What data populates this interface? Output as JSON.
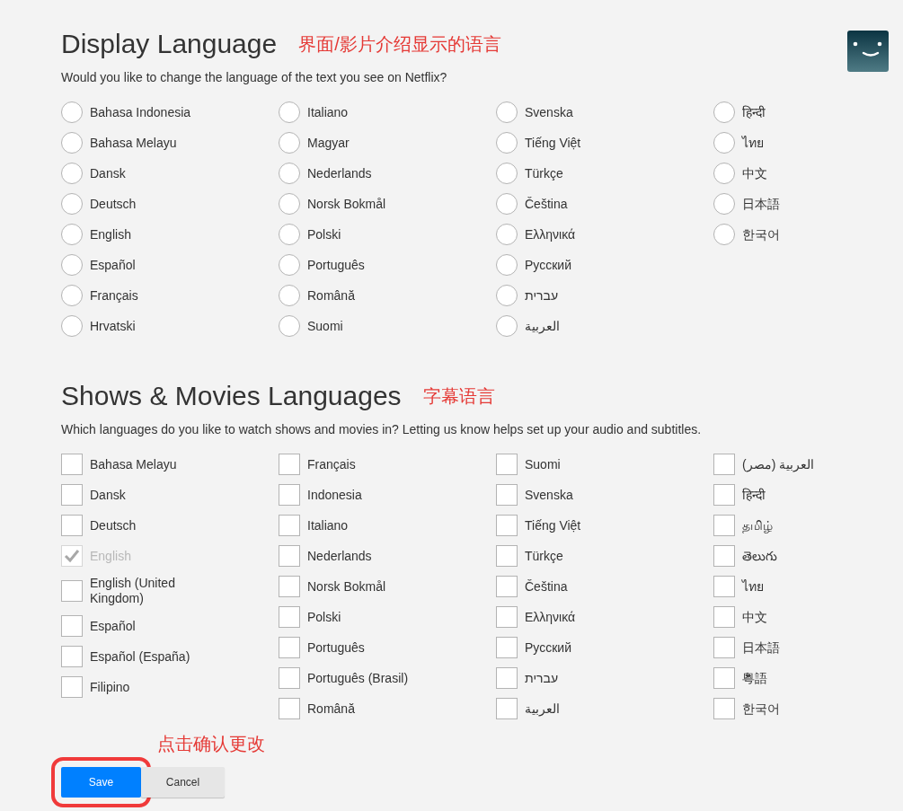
{
  "display_language": {
    "kind": "radio",
    "title": "Display Language",
    "annotation": "界面/影片介绍显示的语言",
    "description": "Would you like to change the language of the text you see on Netflix?",
    "columns": [
      [
        {
          "label": "Bahasa Indonesia",
          "selected": false
        },
        {
          "label": "Bahasa Melayu",
          "selected": false
        },
        {
          "label": "Dansk",
          "selected": false
        },
        {
          "label": "Deutsch",
          "selected": false
        },
        {
          "label": "English",
          "selected": false
        },
        {
          "label": "Español",
          "selected": false
        },
        {
          "label": "Français",
          "selected": false
        },
        {
          "label": "Hrvatski",
          "selected": false
        }
      ],
      [
        {
          "label": "Italiano",
          "selected": false
        },
        {
          "label": "Magyar",
          "selected": false
        },
        {
          "label": "Nederlands",
          "selected": false
        },
        {
          "label": "Norsk Bokmål",
          "selected": false
        },
        {
          "label": "Polski",
          "selected": false
        },
        {
          "label": "Português",
          "selected": false
        },
        {
          "label": "Română",
          "selected": false
        },
        {
          "label": "Suomi",
          "selected": false
        }
      ],
      [
        {
          "label": "Svenska",
          "selected": false
        },
        {
          "label": "Tiếng Việt",
          "selected": false
        },
        {
          "label": "Türkçe",
          "selected": false
        },
        {
          "label": "Čeština",
          "selected": false
        },
        {
          "label": "Ελληνικά",
          "selected": false
        },
        {
          "label": "Русский",
          "selected": false
        },
        {
          "label": "עברית",
          "selected": false
        },
        {
          "label": "العربية",
          "selected": false
        }
      ],
      [
        {
          "label": "हिन्दी",
          "selected": false
        },
        {
          "label": "ไทย",
          "selected": false
        },
        {
          "label": "中文",
          "selected": false
        },
        {
          "label": "日本語",
          "selected": false
        },
        {
          "label": "한국어",
          "selected": false
        }
      ]
    ]
  },
  "shows_languages": {
    "kind": "checkbox",
    "title": "Shows & Movies Languages",
    "annotation": "字幕语言",
    "description": "Which languages do you like to watch shows and movies in? Letting us know helps set up your audio and subtitles.",
    "columns": [
      [
        {
          "label": "Bahasa Melayu",
          "checked": false,
          "disabled": false
        },
        {
          "label": "Dansk",
          "checked": false,
          "disabled": false
        },
        {
          "label": "Deutsch",
          "checked": false,
          "disabled": false
        },
        {
          "label": "English",
          "checked": true,
          "disabled": true
        },
        {
          "label": "English (United Kingdom)",
          "checked": false,
          "disabled": false
        },
        {
          "label": "Español",
          "checked": false,
          "disabled": false
        },
        {
          "label": "Español (España)",
          "checked": false,
          "disabled": false
        },
        {
          "label": "Filipino",
          "checked": false,
          "disabled": false
        }
      ],
      [
        {
          "label": "Français",
          "checked": false,
          "disabled": false
        },
        {
          "label": "Indonesia",
          "checked": false,
          "disabled": false
        },
        {
          "label": "Italiano",
          "checked": false,
          "disabled": false
        },
        {
          "label": "Nederlands",
          "checked": false,
          "disabled": false
        },
        {
          "label": "Norsk Bokmål",
          "checked": false,
          "disabled": false
        },
        {
          "label": "Polski",
          "checked": false,
          "disabled": false
        },
        {
          "label": "Português",
          "checked": false,
          "disabled": false
        },
        {
          "label": "Português (Brasil)",
          "checked": false,
          "disabled": false
        },
        {
          "label": "Română",
          "checked": false,
          "disabled": false
        }
      ],
      [
        {
          "label": "Suomi",
          "checked": false,
          "disabled": false
        },
        {
          "label": "Svenska",
          "checked": false,
          "disabled": false
        },
        {
          "label": "Tiếng Việt",
          "checked": false,
          "disabled": false
        },
        {
          "label": "Türkçe",
          "checked": false,
          "disabled": false
        },
        {
          "label": "Čeština",
          "checked": false,
          "disabled": false
        },
        {
          "label": "Ελληνικά",
          "checked": false,
          "disabled": false
        },
        {
          "label": "Русский",
          "checked": false,
          "disabled": false
        },
        {
          "label": "עברית",
          "checked": false,
          "disabled": false
        },
        {
          "label": "العربية",
          "checked": false,
          "disabled": false
        }
      ],
      [
        {
          "label": "العربية (مصر)",
          "checked": false,
          "disabled": false
        },
        {
          "label": "हिन्दी",
          "checked": false,
          "disabled": false
        },
        {
          "label": "தமிழ்",
          "checked": false,
          "disabled": false
        },
        {
          "label": "తెలుగు",
          "checked": false,
          "disabled": false
        },
        {
          "label": "ไทย",
          "checked": false,
          "disabled": false
        },
        {
          "label": "中文",
          "checked": false,
          "disabled": false
        },
        {
          "label": "日本語",
          "checked": false,
          "disabled": false
        },
        {
          "label": "粵語",
          "checked": false,
          "disabled": false
        },
        {
          "label": "한국어",
          "checked": false,
          "disabled": false
        }
      ]
    ]
  },
  "footer_annotation": "点击确认更改",
  "buttons": [
    {
      "label": "Save",
      "kind": "primary",
      "highlighted": true
    },
    {
      "label": "Cancel",
      "kind": "secondary",
      "highlighted": false
    }
  ]
}
